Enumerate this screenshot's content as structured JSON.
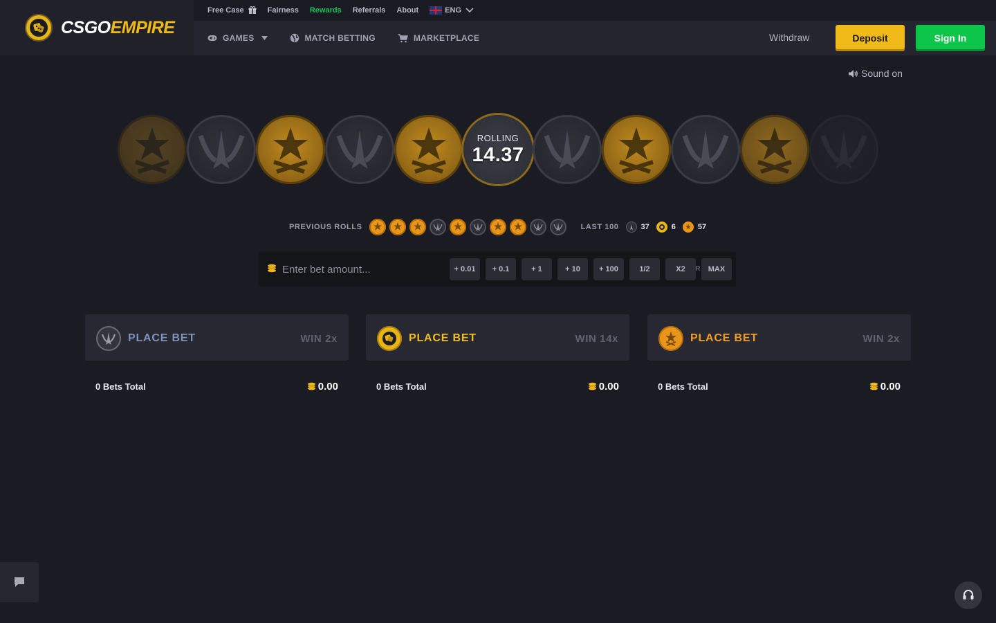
{
  "brand": {
    "name_white": "CSGO",
    "name_yellow": "EMPIRE"
  },
  "topbar": {
    "items": [
      {
        "label": "Free Case"
      },
      {
        "label": "Fairness"
      },
      {
        "label": "Rewards"
      },
      {
        "label": "Referrals"
      },
      {
        "label": "About"
      }
    ],
    "language": "ENG"
  },
  "nav": {
    "games": "GAMES",
    "match_betting": "MATCH BETTING",
    "marketplace": "MARKETPLACE"
  },
  "account": {
    "withdraw": "Withdraw",
    "deposit": "Deposit",
    "sign_in": "Sign In"
  },
  "sound": {
    "label": "Sound on"
  },
  "roulette": {
    "strip": [
      "t",
      "ct",
      "t",
      "ct",
      "t",
      "rolling",
      "ct",
      "t",
      "ct",
      "t",
      "ct"
    ],
    "rolling_label": "ROLLING",
    "rolling_value": "14.37"
  },
  "previous_rolls": {
    "label": "PREVIOUS ROLLS",
    "rolls": [
      "t",
      "t",
      "t",
      "ct",
      "t",
      "ct",
      "t",
      "t",
      "ct",
      "ct"
    ]
  },
  "last100": {
    "label": "LAST 100",
    "ct": "37",
    "bonus": "6",
    "t": "57"
  },
  "bet": {
    "placeholder": "Enter bet amount...",
    "clear": "CLEAR",
    "chips": [
      "+ 0.01",
      "+ 0.1",
      "+ 1",
      "+ 10",
      "+ 100",
      "1/2",
      "X2",
      "MAX"
    ]
  },
  "columns": [
    {
      "place_label": "PLACE BET",
      "win_label": "WIN 2x",
      "bets_total": "0 Bets Total",
      "amount": "0.00"
    },
    {
      "place_label": "PLACE BET",
      "win_label": "WIN 14x",
      "bets_total": "0 Bets Total",
      "amount": "0.00"
    },
    {
      "place_label": "PLACE BET",
      "win_label": "WIN 2x",
      "bets_total": "0 Bets Total",
      "amount": "0.00"
    }
  ],
  "colors": {
    "accent_yellow": "#efb918",
    "accent_green": "#0ec54c",
    "t_orange": "#e8961a",
    "background": "#1b1c23"
  }
}
